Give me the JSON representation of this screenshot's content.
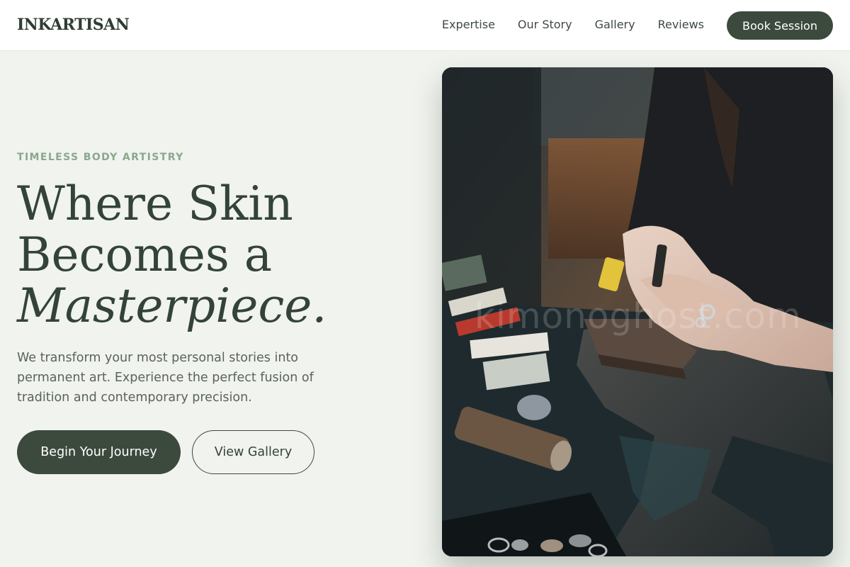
{
  "header": {
    "logo": "INKARTISAN",
    "nav": [
      "Expertise",
      "Our Story",
      "Gallery",
      "Reviews"
    ],
    "cta": "Book Session"
  },
  "hero": {
    "eyebrow": "TIMELESS BODY ARTISTRY",
    "headline": [
      "Where Skin",
      "Becomes a",
      "Masterpiece."
    ],
    "description": "We transform your most personal stories into permanent art. Experience the perfect fusion of tradition and contemporary precision.",
    "primary_button": "Begin Your Journey",
    "secondary_button": "View Gallery"
  },
  "photo": {
    "watermark": "kimonoghost.com"
  },
  "colors": {
    "accent_dark": "#3c4a3e",
    "eyebrow": "#8aa88c",
    "background": "#f0f3ee"
  }
}
